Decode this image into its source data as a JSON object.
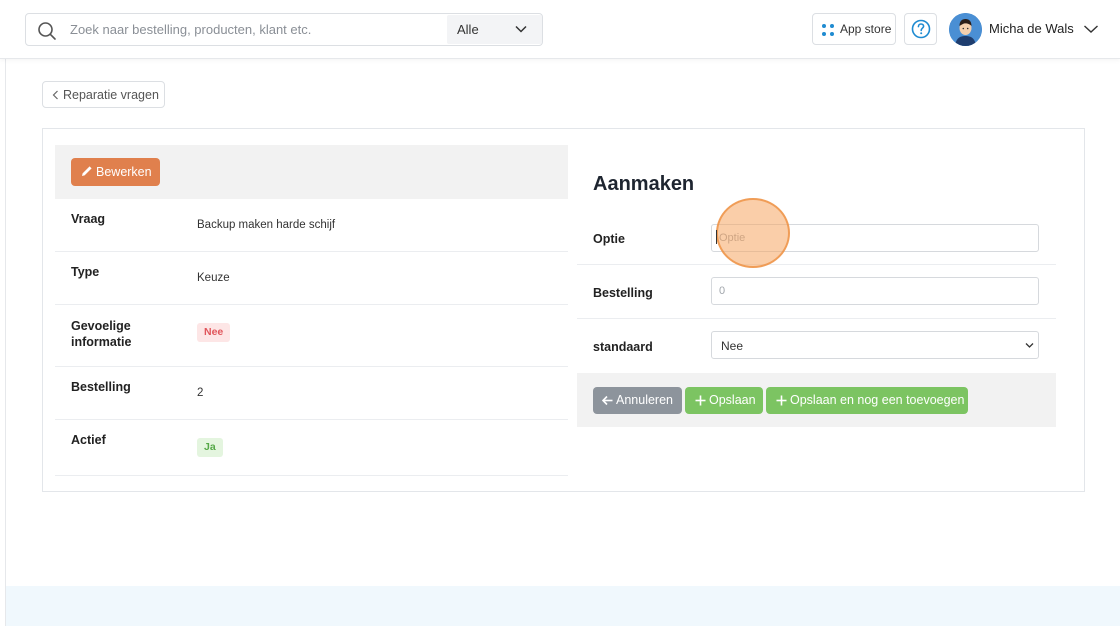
{
  "header": {
    "search": {
      "placeholder": "Zoek naar bestelling, producten, klant etc.",
      "value": ""
    },
    "scope_select": {
      "selected": "Alle"
    },
    "app_store_label": "App store",
    "user": {
      "name": "Micha de Wals"
    }
  },
  "page": {
    "back_label": "Reparatie vragen",
    "edit_label": "Bewerken",
    "details": [
      {
        "label": "Vraag",
        "value": "Backup maken harde schijf"
      },
      {
        "label": "Type",
        "value": "Keuze"
      },
      {
        "label": "Gevoelige informatie",
        "value": "Nee"
      },
      {
        "label": "Bestelling",
        "value": "2"
      },
      {
        "label": "Actief",
        "value": "Ja"
      }
    ],
    "form": {
      "title": "Aanmaken",
      "optie": {
        "label": "Optie",
        "placeholder": "Optie",
        "value": ""
      },
      "bestelling": {
        "label": "Bestelling",
        "placeholder": "0",
        "value": ""
      },
      "standaard": {
        "label": "standaard",
        "selected": "Nee"
      },
      "buttons": {
        "cancel": "Annuleren",
        "save": "Opslaan",
        "save_new": "Opslaan en nog een toevoegen"
      }
    }
  },
  "colors": {
    "edit_button": "#e0804d",
    "save_button": "#7cc462",
    "cancel_button": "#8d949c",
    "badge_no_bg": "#fde6e6",
    "badge_yes_bg": "#e4f5df",
    "accent_blue": "#1f8bd1"
  }
}
